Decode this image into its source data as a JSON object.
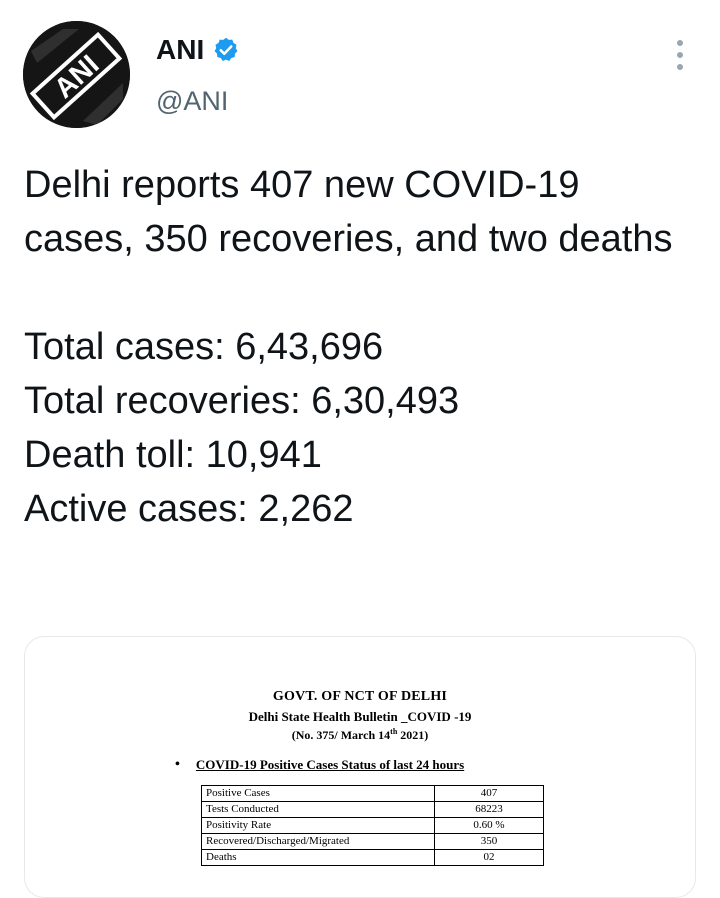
{
  "author": {
    "name": "ANI",
    "handle": "@ANI",
    "avatar_text": "ANI",
    "verified_color": "#1d9bf0"
  },
  "tweet": {
    "headline": "Delhi reports 407 new COVID-19 cases, 350 recoveries, and two deaths",
    "lines": [
      "Total cases: 6,43,696",
      "Total recoveries: 6,30,493",
      "Death toll: 10,941",
      "Active cases: 2,262"
    ]
  },
  "bulletin": {
    "header1": "GOVT. OF NCT OF DELHI",
    "header2": "Delhi State Health Bulletin _COVID -19",
    "header3_prefix": "(No. 375/ March 14",
    "header3_sup": "th",
    "header3_suffix": " 2021)",
    "section_title": "COVID-19 Positive Cases Status of last 24 hours",
    "rows": [
      {
        "label": "Positive Cases",
        "value": "407"
      },
      {
        "label": "Tests Conducted",
        "value": "68223"
      },
      {
        "label": "Positivity Rate",
        "value": "0.60 %"
      },
      {
        "label": "Recovered/Discharged/Migrated",
        "value": "350"
      },
      {
        "label": "Deaths",
        "value": "02"
      }
    ]
  },
  "icons": {
    "verified": "verified-badge-icon",
    "more": "more-vertical-icon"
  }
}
